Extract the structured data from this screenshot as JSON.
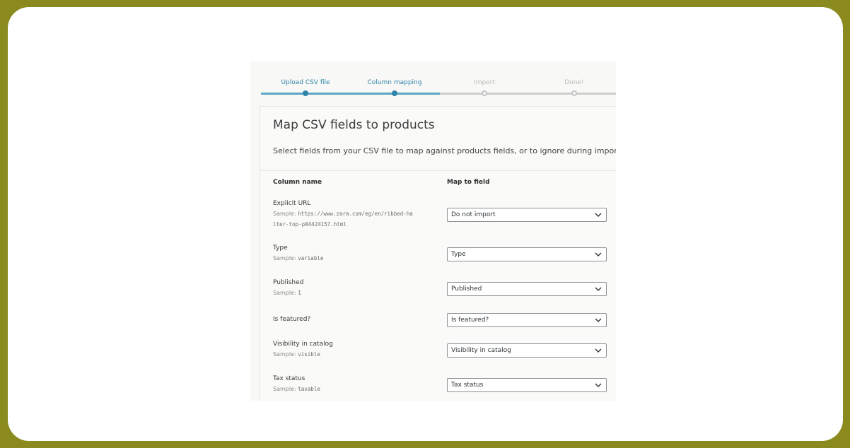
{
  "steps": [
    {
      "label": "Upload CSV file",
      "state": "done"
    },
    {
      "label": "Column mapping",
      "state": "active"
    },
    {
      "label": "Import",
      "state": "todo"
    },
    {
      "label": "Done!",
      "state": "todo"
    }
  ],
  "panel": {
    "title": "Map CSV fields to products",
    "description": "Select fields from your CSV file to map against products fields, or to ignore during import.",
    "column_name_header": "Column name",
    "map_to_field_header": "Map to field"
  },
  "sample_prefix": "Sample:",
  "rows": [
    {
      "name": "Explicit URL",
      "sample_line1": "https://www.zara.com/eg/en/ribbed-ha",
      "sample_line2": "lter-top-p04424157.html",
      "mapping": "Do not import"
    },
    {
      "name": "Type",
      "sample_line1": "variable",
      "mapping": "Type"
    },
    {
      "name": "Published",
      "sample_line1": "1",
      "mapping": "Published"
    },
    {
      "name": "Is featured?",
      "mapping": "Is featured?"
    },
    {
      "name": "Visibility in catalog",
      "sample_line1": "visible",
      "mapping": "Visibility in catalog"
    },
    {
      "name": "Tax status",
      "sample_line1": "taxable",
      "mapping": "Tax status"
    }
  ],
  "colors": {
    "frame_background": "#8a8a1e",
    "accent": "#2e84a8",
    "progress_done": "#5ba7c4",
    "progress_todo": "#cdcdcd"
  }
}
